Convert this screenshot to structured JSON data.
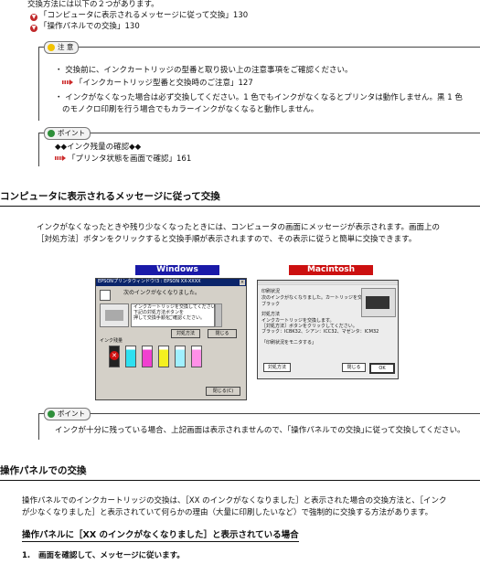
{
  "intro": {
    "text": "交換方法には以下の２つがあります。",
    "links": [
      {
        "text": "「コンピュータに表示されるメッセージに従って交換」130"
      },
      {
        "text": "「操作パネルでの交換」130"
      }
    ]
  },
  "caution": {
    "badge": "注 意",
    "bullet1": "交換前に、インクカートリッジの型番と取り扱い上の注意事項をご確認ください。",
    "ref1": "「インクカートリッジ型番と交換時のご注意」127",
    "bullet2_line1": "インクがなくなった場合は必ず交換してください。1 色でもインクがなくなるとプリンタは動作しません。黒 1 色",
    "bullet2_line2": "のモノクロ印刷を行う場合でもカラーインクがなくなると動作しません。"
  },
  "point1": {
    "badge": "ポイント",
    "line1": "◆◆インク残量の確認◆◆",
    "ref": "「プリンタ状態を画面で確認」161"
  },
  "section1": {
    "heading": "コンピュータに表示されるメッセージに従って交換",
    "para_line1": "インクがなくなったときや残り少なくなったときには、コンピュータの画面にメッセージが表示されます。画面上の",
    "para_line2": "［対処方法］ボタンをクリックすると交換手順が表示されますので、その表示に従うと簡単に交換できます。"
  },
  "screens": {
    "windows_label": "Windows",
    "mac_label": "Macintosh",
    "windows_colors": {
      "header": "#1a1aa8",
      "mac_header": "#cc1010"
    },
    "win_title": "EPSONプリンタウィンドウ!3 : EPSON XX-XXXX",
    "win_message": "次のインクがなくなりました。",
    "win_detail_1": "インクカートリッジを交換してください。",
    "win_detail_2": "下記の対処方法ボタンを",
    "win_detail_3": "押して交換手順を",
    "win_detail_4": "ご確認ください。",
    "win_btn_fix": "対処方法",
    "win_btn_close": "閉じる",
    "win_ink_label": "インク残量",
    "win_btn_close2": "閉じる(C)",
    "mac_title": "印刷状況",
    "mac_line1": "次のインクがなくなりました。カートリッジを交換してください。",
    "mac_line2": "ブラック",
    "mac_sub": "対処方法",
    "mac_line3": "インクカートリッジを交換します。",
    "mac_line4": "［対処方法］ボタンをクリックしてください。",
    "mac_line5": "ブラック：ICBK32、シアン：ICC32、マゼンタ：ICM32",
    "mac_line6": "「印刷状況をモニタする」",
    "mac_btn1": "対処方法",
    "mac_btn2": "閉じる",
    "mac_btn3": "OK"
  },
  "point2": {
    "badge": "ポイント",
    "text": "インクが十分に残っている場合、上記画面は表示されませんので、｢操作パネルでの交換｣に従って交換してください。"
  },
  "section2": {
    "heading": "操作パネルでの交換",
    "para_line1": "操作パネルでのインクカートリッジの交換は、［XX のインクがなくなりました］と表示された場合の交換方法と、［インク",
    "para_line2": "が少なくなりました］と表示されていて何らかの理由（大量に印刷したいなど）で強制的に交換する方法があります。"
  },
  "subsection": {
    "heading": "操作パネルに［XX のインクがなくなりました］と表示されている場合"
  },
  "step1": {
    "number": "1.",
    "text": "画面を確認して、メッセージに従います。"
  }
}
